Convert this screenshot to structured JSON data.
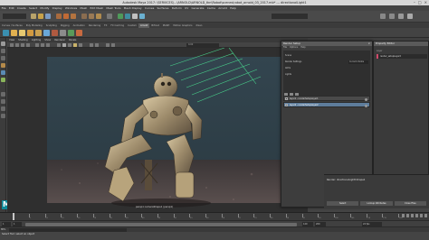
{
  "window": {
    "title": "Autodesk Maya 2017: \\SERVICES\\...\\ARNOLD\\ARNOLD_tkn\\Robot\\scenes\\robot_arnold_03_2017.mb* --- directionalLight1",
    "controls": [
      "–",
      "□",
      "×"
    ]
  },
  "menubar": [
    "File",
    "Edit",
    "Create",
    "Select",
    "Modify",
    "Display",
    "Windows",
    "Mesh",
    "Edit Mesh",
    "Mesh Tools",
    "Mesh Display",
    "Curves",
    "Surfaces",
    "Deform",
    "UV",
    "Generate",
    "Cache",
    "Arnold",
    "Help"
  ],
  "shelf": {
    "tabs": [
      "Curves / Surfaces",
      "Poly Modeling",
      "Sculpting",
      "Rigging",
      "Animation",
      "Rendering",
      "FX",
      "FX Caching",
      "Custom",
      "Arnold",
      "Bifrost",
      "MASH",
      "Motion Graphics",
      "XGen"
    ],
    "active_tab": "Arnold"
  },
  "viewport": {
    "menu": [
      "View",
      "Shading",
      "Lighting",
      "Show",
      "Renderer",
      "Panels"
    ],
    "field_value": "0.00",
    "camera_label": "persp1:cameraShape1 (persp1)"
  },
  "render_setup": {
    "title": "Render Setup",
    "menu": [
      "File",
      "Options",
      "Help"
    ],
    "tree_rows": [
      {
        "label": "Scene",
        "value": ""
      },
      {
        "label": "Render Settings",
        "value": "Current Visible"
      },
      {
        "label": "AOVs",
        "value": ""
      },
      {
        "label": "Lights",
        "value": ""
      }
    ],
    "layers": [
      {
        "label": "layer1 - renderSetupLayer1",
        "selected": false
      },
      {
        "label": "layer2 - renderSetupLayer2",
        "selected": true
      }
    ]
  },
  "property_editor": {
    "title": "Property Editor",
    "label": "Layer",
    "field_value": "render_setupLayer2"
  },
  "output": {
    "text": "Render: directionalLight1Shape1",
    "buttons": [
      "Select",
      "Lookup Attributes",
      "Close Files"
    ]
  },
  "timeline": {
    "ticks": [
      "1",
      "5",
      "10",
      "15",
      "20",
      "25",
      "30",
      "35",
      "40",
      "45",
      "50",
      "55",
      "60",
      "65",
      "70",
      "75",
      "80",
      "85",
      "90",
      "95",
      "100",
      "105",
      "110",
      "115",
      "120"
    ],
    "current_frame": "1"
  },
  "range": {
    "start": "1",
    "range_start": "1",
    "range_end": "120",
    "end": "200",
    "fps": "24 fps"
  },
  "cmdline": {
    "label": "MEL"
  },
  "help_text": "Select Tool: select an object"
}
